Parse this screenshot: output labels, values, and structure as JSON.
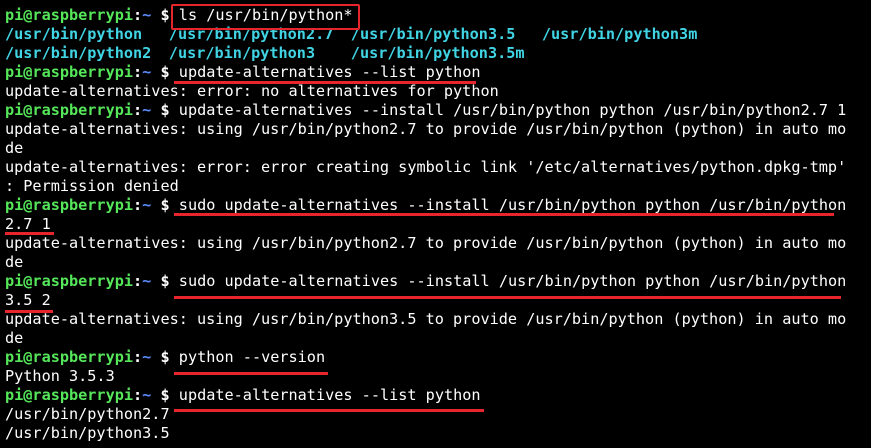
{
  "terminal": {
    "prompt": {
      "user_host": "pi@raspberrypi",
      "sep": ":",
      "path": "~",
      "dollar": "$"
    },
    "lines": [
      {
        "type": "cmd",
        "text": "ls /usr/bin/python*"
      },
      {
        "type": "ls",
        "cols": [
          "/usr/bin/python",
          "/usr/bin/python2.7",
          "/usr/bin/python3.5",
          "/usr/bin/python3m"
        ]
      },
      {
        "type": "ls",
        "cols": [
          "/usr/bin/python2",
          "/usr/bin/python3",
          "/usr/bin/python3.5m"
        ]
      },
      {
        "type": "cmd",
        "text": "update-alternatives --list python"
      },
      {
        "type": "out",
        "text": "update-alternatives: error: no alternatives for python"
      },
      {
        "type": "cmd",
        "text": "update-alternatives --install /usr/bin/python python /usr/bin/python2.7 1"
      },
      {
        "type": "out",
        "text": "update-alternatives: using /usr/bin/python2.7 to provide /usr/bin/python (python) in auto mo"
      },
      {
        "type": "out",
        "text": "de"
      },
      {
        "type": "out",
        "text": "update-alternatives: error: error creating symbolic link '/etc/alternatives/python.dpkg-tmp'"
      },
      {
        "type": "out",
        "text": ": Permission denied"
      },
      {
        "type": "cmd",
        "text": "sudo update-alternatives --install /usr/bin/python python /usr/bin/python"
      },
      {
        "type": "out",
        "text": "2.7 1"
      },
      {
        "type": "out",
        "text": "update-alternatives: using /usr/bin/python2.7 to provide /usr/bin/python (python) in auto mo"
      },
      {
        "type": "out",
        "text": "de"
      },
      {
        "type": "cmd",
        "text": "sudo update-alternatives --install /usr/bin/python python /usr/bin/python"
      },
      {
        "type": "out",
        "text": "3.5 2"
      },
      {
        "type": "out",
        "text": "update-alternatives: using /usr/bin/python3.5 to provide /usr/bin/python (python) in auto mo"
      },
      {
        "type": "out",
        "text": "de"
      },
      {
        "type": "cmd",
        "text": "python --version"
      },
      {
        "type": "out",
        "text": "Python 3.5.3"
      },
      {
        "type": "cmd",
        "text": "update-alternatives --list python"
      },
      {
        "type": "out",
        "text": "/usr/bin/python2.7"
      },
      {
        "type": "out",
        "text": "/usr/bin/python3.5"
      }
    ]
  },
  "colors": {
    "background": "#000000",
    "prompt_user": "#55e65a",
    "prompt_path": "#5b8cff",
    "ls_executable": "#40d4e4",
    "annotation_red": "#e6262c"
  }
}
